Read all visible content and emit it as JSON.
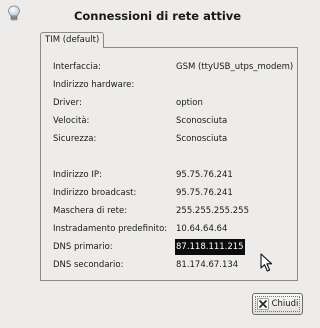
{
  "window": {
    "title": "Connessioni di rete attive"
  },
  "tabs": [
    {
      "label": "TIM (default)"
    }
  ],
  "details": [
    {
      "label": "Interfaccia:",
      "value": "GSM (ttyUSB_utps_modem)"
    },
    {
      "label": "Indirizzo hardware:",
      "value": ""
    },
    {
      "label": "Driver:",
      "value": "option"
    },
    {
      "label": "Velocità:",
      "value": "Sconosciuta"
    },
    {
      "label": "Sicurezza:",
      "value": "Sconosciuta"
    },
    {
      "label": "Indirizzo IP:",
      "value": "95.75.76.241"
    },
    {
      "label": "Indirizzo broadcast:",
      "value": "95.75.76.241"
    },
    {
      "label": "Maschera di rete:",
      "value": "255.255.255.255"
    },
    {
      "label": "Instradamento predefinito:",
      "value": "10.64.64.64"
    },
    {
      "label": "DNS primario:",
      "value": "87.118.111.215"
    },
    {
      "label": "DNS secondario:",
      "value": "81.174.67.134"
    }
  ],
  "buttons": {
    "close_label": "Chiudi"
  },
  "icons": {
    "app": "lightbulb-icon",
    "close": "close-icon",
    "cursor": "mouse-pointer-icon"
  }
}
